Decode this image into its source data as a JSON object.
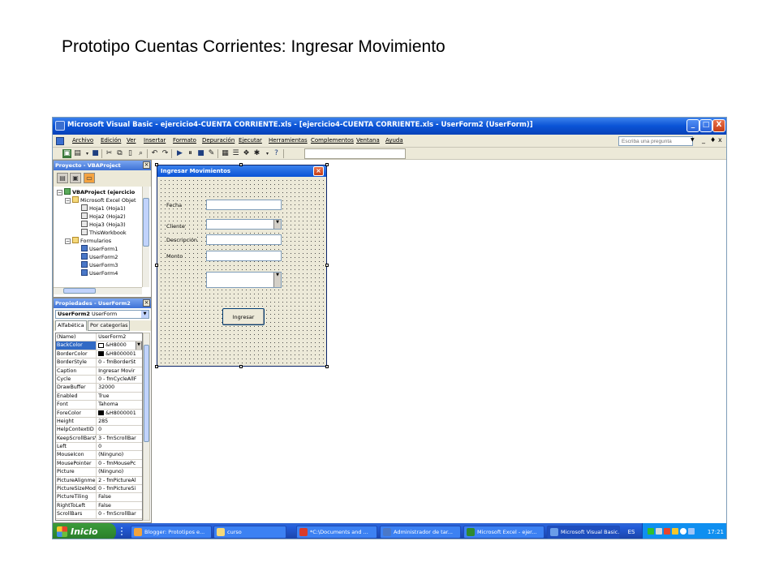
{
  "slide": {
    "title": "Prototipo Cuentas Corrientes: Ingresar Movimiento"
  },
  "window": {
    "title": "Microsoft Visual Basic - ejercicio4-CUENTA CORRIENTE.xls - [ejercicio4-CUENTA CORRIENTE.xls - UserForm2 (UserForm)]",
    "controls": {
      "minimize": "_",
      "maximize": "□",
      "close": "X"
    }
  },
  "menu": {
    "items": [
      "Archivo",
      "Edición",
      "Ver",
      "Insertar",
      "Formato",
      "Depuración",
      "Ejecutar",
      "Herramientas",
      "Complementos",
      "Ventana",
      "Ayuda"
    ],
    "help_placeholder": "Escriba una pregunta",
    "mdi_controls": [
      "_",
      "♦",
      "x"
    ]
  },
  "project": {
    "title": "Proyecto - VBAProject",
    "tree": [
      {
        "label": "VBAProject (ejercicio",
        "level": 0,
        "icon": "vb",
        "expand": "−"
      },
      {
        "label": "Microsoft Excel Objet",
        "level": 1,
        "icon": "folder",
        "expand": "−"
      },
      {
        "label": "Hoja1 (Hoja1)",
        "level": 2,
        "icon": "sheet"
      },
      {
        "label": "Hoja2 (Hoja2)",
        "level": 2,
        "icon": "sheet"
      },
      {
        "label": "Hoja3 (Hoja3)",
        "level": 2,
        "icon": "sheet"
      },
      {
        "label": "ThisWorkbook",
        "level": 2,
        "icon": "sheet"
      },
      {
        "label": "Formularios",
        "level": 1,
        "icon": "folder",
        "expand": "−"
      },
      {
        "label": "UserForm1",
        "level": 2,
        "icon": "form"
      },
      {
        "label": "UserForm2",
        "level": 2,
        "icon": "form"
      },
      {
        "label": "UserForm3",
        "level": 2,
        "icon": "form"
      },
      {
        "label": "UserForm4",
        "level": 2,
        "icon": "form"
      }
    ]
  },
  "properties": {
    "title": "Propiedades - UserForm2",
    "object_name": "UserForm2",
    "object_type": "UserForm",
    "tabs": [
      "Alfabética",
      "Por categorías"
    ],
    "rows": [
      {
        "name": "(Name)",
        "value": "UserForm2"
      },
      {
        "name": "BackColor",
        "value": "&H8000",
        "swatch": "#ffffff",
        "selected": true
      },
      {
        "name": "BorderColor",
        "value": "&H8000001",
        "swatch": "#000000"
      },
      {
        "name": "BorderStyle",
        "value": "0 - fmBorderSt"
      },
      {
        "name": "Caption",
        "value": "Ingresar Movir"
      },
      {
        "name": "Cycle",
        "value": "0 - fmCycleAllF"
      },
      {
        "name": "DrawBuffer",
        "value": "32000"
      },
      {
        "name": "Enabled",
        "value": "True"
      },
      {
        "name": "Font",
        "value": "Tahoma"
      },
      {
        "name": "ForeColor",
        "value": "&H8000001",
        "swatch": "#000000"
      },
      {
        "name": "Height",
        "value": "285"
      },
      {
        "name": "HelpContextID",
        "value": "0"
      },
      {
        "name": "KeepScrollBarsV",
        "value": "3 - fmScrollBar"
      },
      {
        "name": "Left",
        "value": "0"
      },
      {
        "name": "MouseIcon",
        "value": "(Ninguno)"
      },
      {
        "name": "MousePointer",
        "value": "0 - fmMousePc"
      },
      {
        "name": "Picture",
        "value": "(Ninguno)"
      },
      {
        "name": "PictureAlignmen",
        "value": "2 - fmPictureAl"
      },
      {
        "name": "PictureSizeMode",
        "value": "0 - fmPictureSi"
      },
      {
        "name": "PictureTiling",
        "value": "False"
      },
      {
        "name": "RightToLeft",
        "value": "False"
      },
      {
        "name": "ScrollBars",
        "value": "0 - fmScrollBar"
      }
    ]
  },
  "form": {
    "caption": "Ingresar Movimientos",
    "labels": {
      "fecha": "Fecha",
      "cliente": "Cliente",
      "descripcion": "Descripción",
      "monto": "Monto"
    },
    "button": "Ingresar"
  },
  "taskbar": {
    "start": "Inicio",
    "tasks": [
      {
        "label": "Blogger: Prototipos e...",
        "color": "#f2a33a"
      },
      {
        "label": "curso",
        "color": "#f5d97a"
      },
      {
        "label": "*C:\\Documents and ...",
        "color": "#d83b2a"
      },
      {
        "label": "Administrador de tar...",
        "color": "#4a78c8"
      },
      {
        "label": "Microsoft Excel - ejer...",
        "color": "#2f8a2f"
      },
      {
        "label": "Microsoft Visual Basic...",
        "color": "#6a9de8",
        "active": true
      }
    ],
    "language": "ES",
    "clock": "17:21"
  }
}
